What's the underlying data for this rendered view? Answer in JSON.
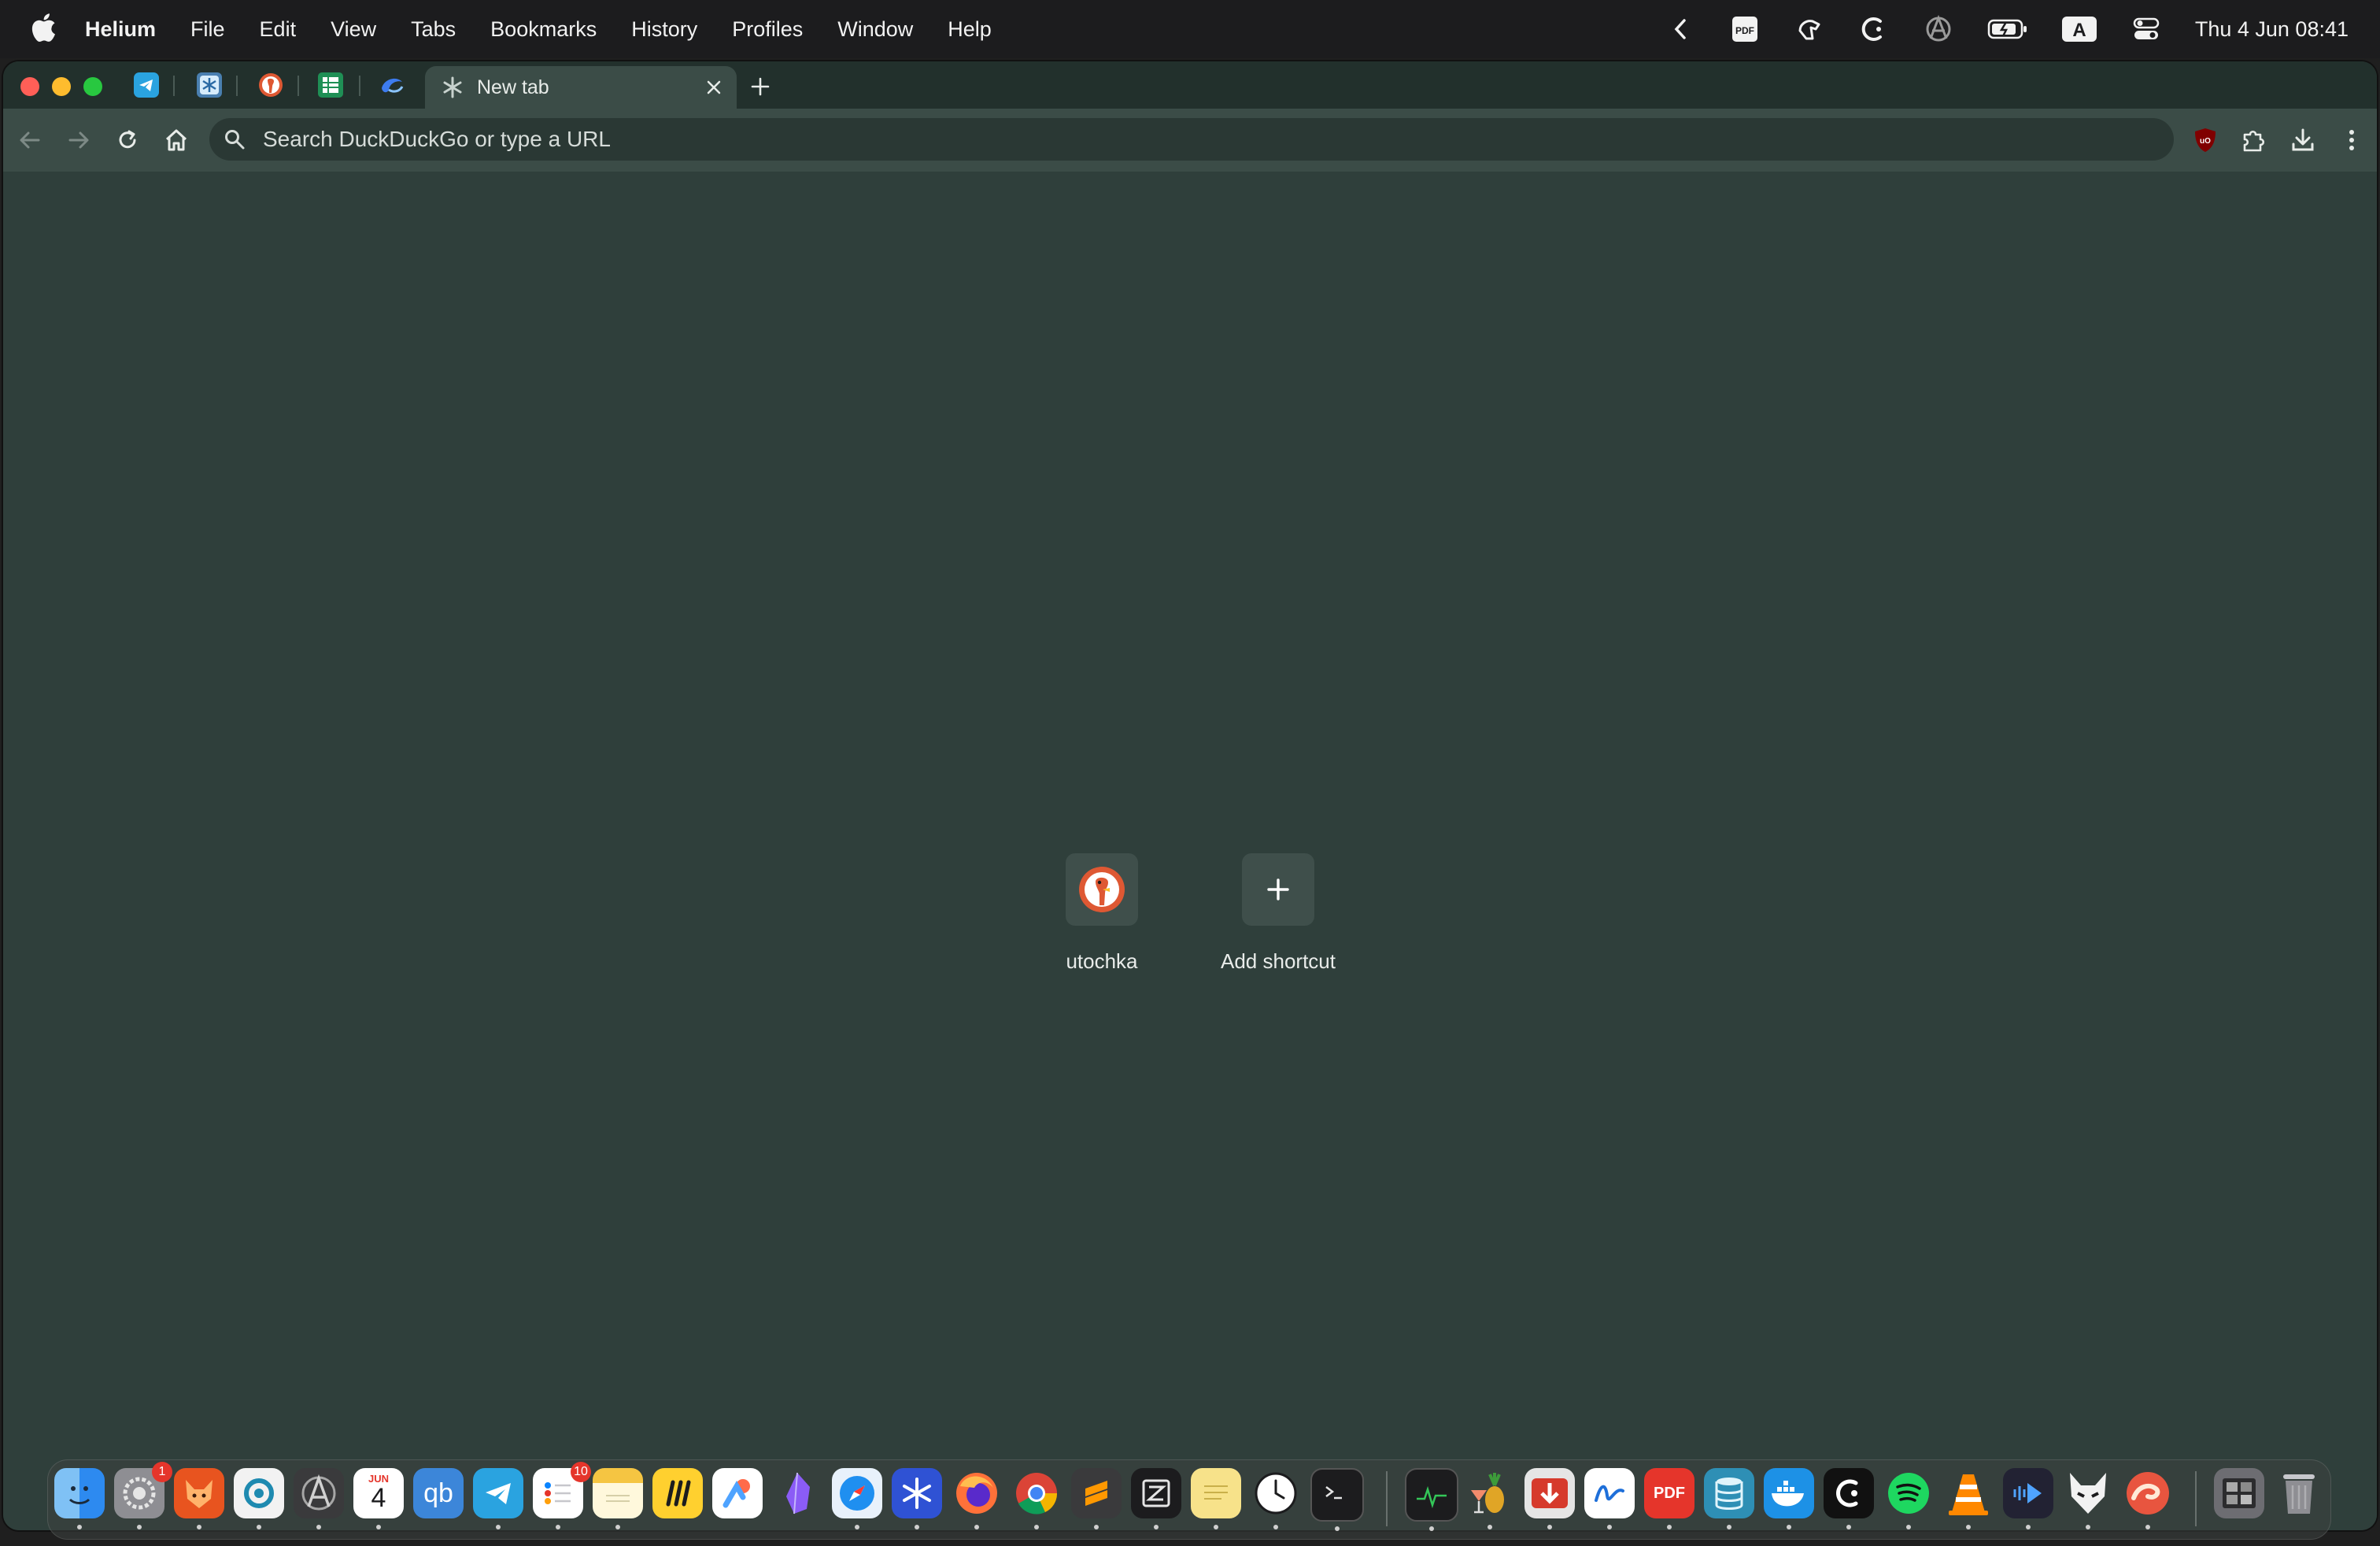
{
  "menubar": {
    "app_name": "Helium",
    "menus": [
      "File",
      "Edit",
      "View",
      "Tabs",
      "Bookmarks",
      "History",
      "Profiles",
      "Window",
      "Help"
    ],
    "status_icons": [
      "chevron-left-icon",
      "pdf-icon",
      "hand-pointer-icon",
      "crescent-icon",
      "anarchy-icon",
      "battery-icon",
      "input-source-icon",
      "control-center-icon"
    ],
    "input_source_label": "A",
    "pdf_label": "PDF",
    "clock": "Thu 4 Jun  08:41"
  },
  "tabs": {
    "pinned": [
      "telegram-icon",
      "snowflake-app-icon",
      "duckduckgo-icon",
      "spreadsheet-icon",
      "edge-icon"
    ],
    "active_title": "New tab",
    "active_icon": "asterisk-icon"
  },
  "omnibox": {
    "placeholder": "Search DuckDuckGo or type a URL"
  },
  "toolbar": {
    "ublock_label": "uO"
  },
  "shortcuts": [
    {
      "label": "utochka",
      "icon": "duckduckgo-icon"
    },
    {
      "label": "Add shortcut",
      "icon": "plus-icon"
    }
  ],
  "dock": {
    "calendar_month": "JUN",
    "calendar_day": "4",
    "qb_label": "qb",
    "pdf_label": "PDF",
    "badges": {
      "settings": "1",
      "reminders": "10"
    }
  },
  "colors": {
    "window_bg": "#2f3f3b",
    "toolbar_bg": "#3b4c47",
    "tabstrip_bg": "#22302c",
    "omnibox_bg": "#2a3834",
    "menubar_bg": "#1c1c1e"
  }
}
